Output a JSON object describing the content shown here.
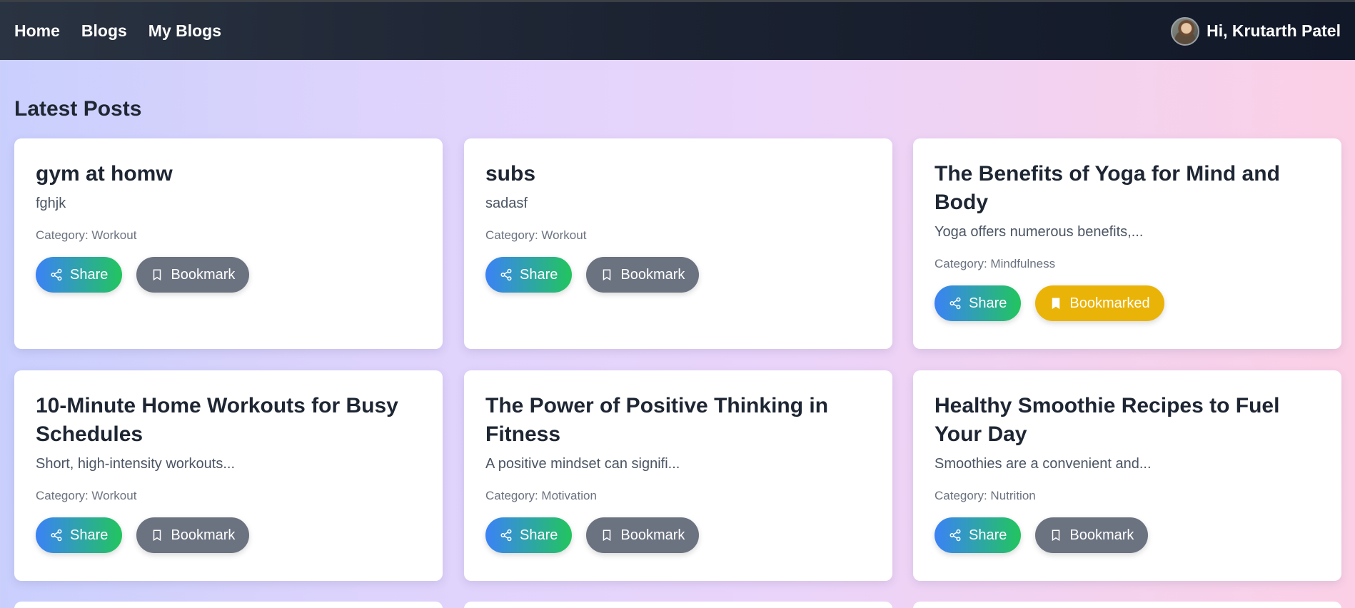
{
  "nav": {
    "links": [
      "Home",
      "Blogs",
      "My Blogs"
    ],
    "greeting": "Hi, Krutarth Patel"
  },
  "main": {
    "section_title": "Latest Posts",
    "share_label": "Share",
    "posts": [
      {
        "title": "gym at homw",
        "excerpt": "fghjk",
        "category": "Category: Workout",
        "bookmark_label": "Bookmark",
        "bookmarked": false
      },
      {
        "title": "subs",
        "excerpt": "sadasf",
        "category": "Category: Workout",
        "bookmark_label": "Bookmark",
        "bookmarked": false
      },
      {
        "title": "The Benefits of Yoga for Mind and Body",
        "excerpt": "Yoga offers numerous benefits,...",
        "category": "Category: Mindfulness",
        "bookmark_label": "Bookmarked",
        "bookmarked": true
      },
      {
        "title": "10-Minute Home Workouts for Busy Schedules",
        "excerpt": "Short, high-intensity workouts...",
        "category": "Category: Workout",
        "bookmark_label": "Bookmark",
        "bookmarked": false
      },
      {
        "title": "The Power of Positive Thinking in Fitness",
        "excerpt": "A positive mindset can signifi...",
        "category": "Category: Motivation",
        "bookmark_label": "Bookmark",
        "bookmarked": false
      },
      {
        "title": "Healthy Smoothie Recipes to Fuel Your Day",
        "excerpt": "Smoothies are a convenient and...",
        "category": "Category: Nutrition",
        "bookmark_label": "Bookmark",
        "bookmarked": false
      }
    ]
  },
  "colors": {
    "share_gradient_start": "#3b82f6",
    "share_gradient_end": "#22c55e",
    "bookmark": "#6b7280",
    "bookmarked": "#eab308",
    "navbar": "#1b2231"
  }
}
